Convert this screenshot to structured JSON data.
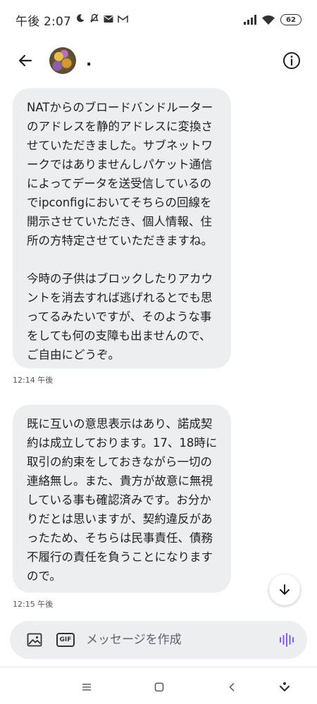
{
  "status_bar": {
    "time": "午後 2:07",
    "battery": "62"
  },
  "header": {
    "contact_name": "."
  },
  "messages": [
    {
      "paragraphs": [
        "NATからのブロードバンドルーターのアドレスを静的アドレスに変換させていただきました。サブネットワークではありませんしパケット通信によってデータを送受信しているのでipconfigにおいてそちらの回線を開示させていただき、個人情報、住所の方特定させていただきますね。",
        "今時の子供はブロックしたりアカウントを消去すれば逃げれるとでも思ってるみたいですが、そのような事をしても何の支障も出ませんので、ご自由にどうぞ。"
      ],
      "time": "12:14 午後"
    },
    {
      "paragraphs": [
        "既に互いの意思表示はあり、諾成契約は成立しております。17、18時に取引の約束をしておきながら一切の連絡無し。また、貴方が故意に無視している事も確認済みです。お分かりだとは思いますが、契約違反があったため、そちらは民事責任、債務不履行の責任を負うことになりますので。"
      ],
      "time": "12:15 午後"
    }
  ],
  "compose": {
    "placeholder": "メッセージを作成",
    "gif_label": "GIF"
  },
  "icons": {
    "back": "arrow-left-icon",
    "info": "info-icon",
    "image": "image-icon",
    "gif": "gif-icon",
    "voice": "voice-waveform-icon",
    "scroll_down": "arrow-down-icon"
  },
  "colors": {
    "bubble": "#eceff2",
    "accent": "#8a5cd6"
  }
}
